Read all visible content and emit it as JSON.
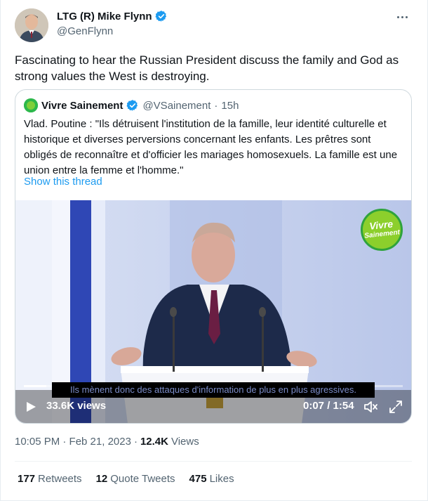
{
  "author": {
    "display_name": "LTG (R) Mike Flynn",
    "handle": "@GenFlynn"
  },
  "tweet_text": "Fascinating to hear the Russian President discuss the family and God as strong values the West is destroying.",
  "quote": {
    "display_name": "Vivre Sainement",
    "handle": "@VSainement",
    "separator": "·",
    "time": "15h",
    "text": "Vlad. Poutine : \"Ils détruisent l'institution de la famille, leur identité culturelle et historique et diverses perversions concernant les enfants. Les prêtres sont obligés de reconnaître et d'officier les mariages homosexuels. La famille est une union entre la femme et l'homme.\"",
    "show_thread": "Show this thread",
    "video": {
      "logo_line1": "Vivre",
      "logo_line2": "Sainement",
      "subtitle": "Ils mènent donc des attaques d'information de plus en plus agressives.",
      "views": "33.6K views",
      "time": "0:07 / 1:54",
      "progress_fraction": 0.06
    }
  },
  "meta": {
    "timestamp": "10:05 PM · Feb 21, 2023",
    "separator": "·",
    "views_count": "12.4K",
    "views_label": "Views"
  },
  "stats": {
    "retweets_count": "177",
    "retweets_label": "Retweets",
    "quotes_count": "12",
    "quotes_label": "Quote Tweets",
    "likes_count": "475",
    "likes_label": "Likes"
  },
  "colors": {
    "accent": "#1d9bf0",
    "secondary_text": "#536471",
    "verified": "#1d9bf0"
  },
  "icons": {
    "verified": "verified-badge-icon",
    "more": "more-horizontal-icon",
    "play": "play-icon",
    "volume": "volume-icon",
    "fullscreen": "fullscreen-icon"
  }
}
